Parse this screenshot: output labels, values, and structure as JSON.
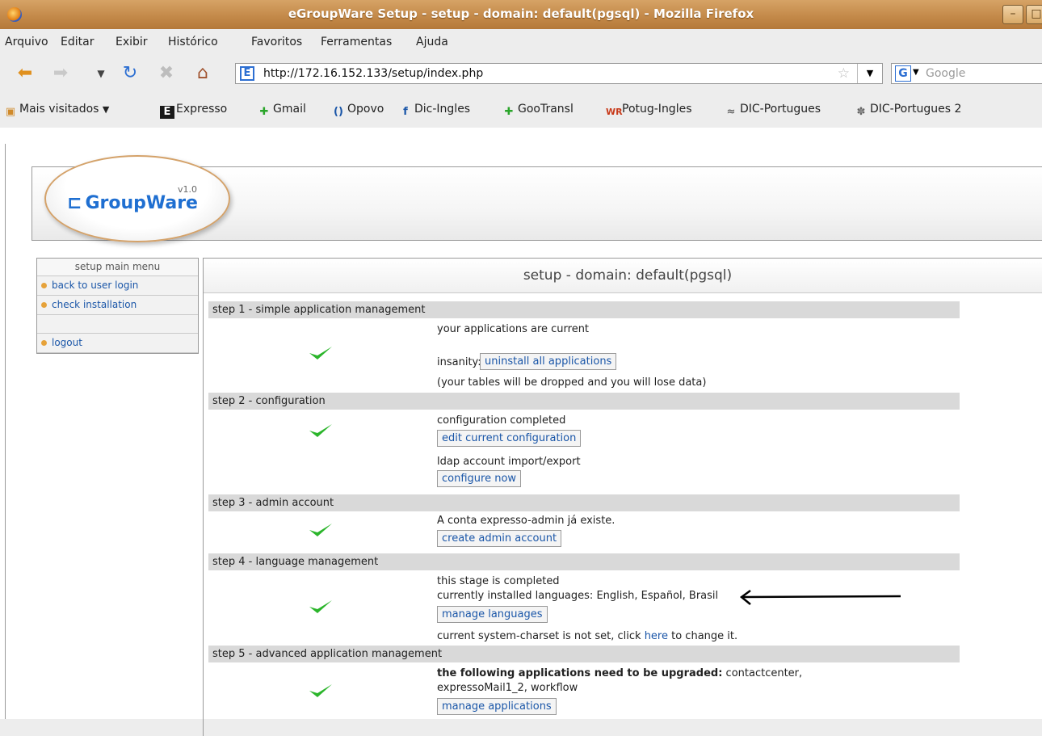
{
  "window": {
    "title": "eGroupWare Setup - setup - domain: default(pgsql) - Mozilla Firefox"
  },
  "menu": [
    "Arquivo",
    "Editar",
    "Exibir",
    "Histórico",
    "Favoritos",
    "Ferramentas",
    "Ajuda"
  ],
  "nav": {
    "url": "http://172.16.152.133/setup/index.php",
    "search_placeholder": "Google"
  },
  "bookmarks": [
    "Mais visitados",
    "Expresso",
    "Gmail",
    "Opovo",
    "Dic-Ingles",
    "GooTransl",
    "Potug-Ingles",
    "DIC-Portugues",
    "DIC-Portugues 2"
  ],
  "logo": {
    "name": "GroupWare",
    "version": "v1.0"
  },
  "sidebar": {
    "title": "setup main menu",
    "items": [
      "back to user login",
      "check installation",
      "logout"
    ]
  },
  "main": {
    "title": "setup - domain: default(pgsql)",
    "step1": {
      "head": "step 1 - simple application management",
      "status": "your applications are current",
      "insanity_label": "insanity:",
      "button": "uninstall all applications",
      "note": "(your tables will be dropped and you will lose data)"
    },
    "step2": {
      "head": "step 2 - configuration",
      "status": "configuration completed",
      "button": "edit current configuration",
      "ldap_label": "ldap account import/export",
      "ldap_button": "configure now"
    },
    "step3": {
      "head": "step 3 - admin account",
      "status": "A conta expresso-admin já existe.",
      "button": "create admin account"
    },
    "step4": {
      "head": "step 4 - language management",
      "status": "this stage is completed",
      "languages": "currently installed languages: English, Español, Brasil",
      "button": "manage languages",
      "charset_before": "current system-charset is not set, click",
      "charset_link": "here",
      "charset_after": "to change it."
    },
    "step5": {
      "head": "step 5 - advanced application management",
      "upgrade_label": "the following applications need to be upgraded:",
      "upgrade_apps_line1": "contactcenter,",
      "upgrade_apps_line2": "expressoMail1_2, workflow",
      "button": "manage applications"
    }
  }
}
